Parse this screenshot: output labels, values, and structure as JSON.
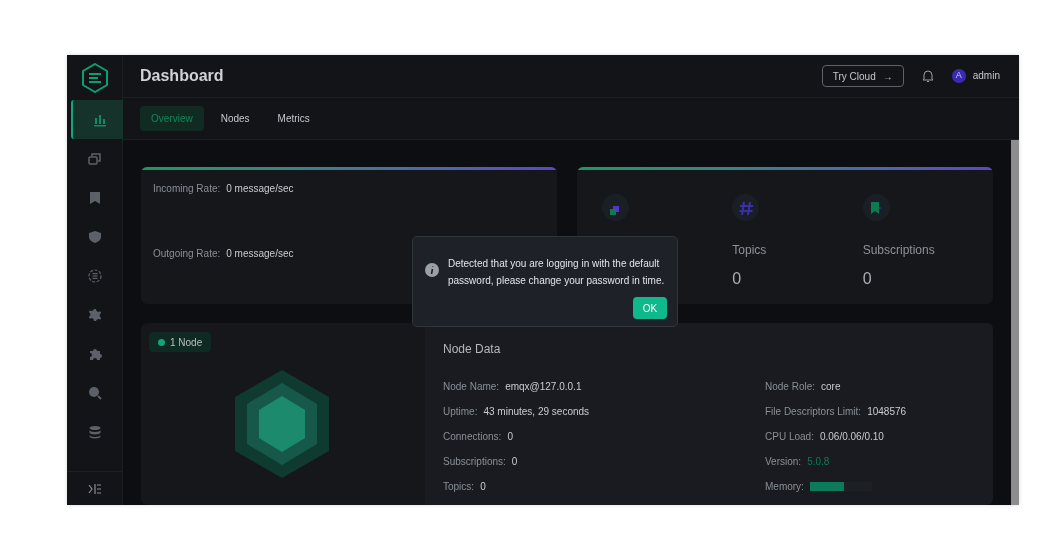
{
  "header": {
    "title": "Dashboard",
    "cloud_button": "Try Cloud",
    "cloud_arrow": "→",
    "avatar": "A",
    "user": "admin"
  },
  "sidebar": {
    "items": [
      {
        "kind": "chart",
        "selected": true
      },
      {
        "kind": "clients",
        "selected": false
      },
      {
        "kind": "bookmark",
        "selected": false
      },
      {
        "kind": "shield",
        "selected": false
      },
      {
        "kind": "list",
        "selected": false
      },
      {
        "kind": "gear",
        "selected": false
      },
      {
        "kind": "puzzle",
        "selected": false
      },
      {
        "kind": "search",
        "selected": false
      },
      {
        "kind": "database",
        "selected": false
      }
    ]
  },
  "tabs": [
    {
      "label": "Overview",
      "selected": true
    },
    {
      "label": "Nodes",
      "selected": false
    },
    {
      "label": "Metrics",
      "selected": false
    }
  ],
  "rates": [
    {
      "label": "Incoming Rate:",
      "value": "0 message/sec"
    },
    {
      "label": "Outgoing Rate:",
      "value": "0 message/sec"
    }
  ],
  "stats": [
    {
      "kind": "clients"
    },
    {
      "kind": "topics",
      "label": "Topics",
      "value": "0"
    },
    {
      "kind": "subscriptions",
      "label": "Subscriptions",
      "value": "0"
    }
  ],
  "nodes_badge": "1 Node",
  "node_data": {
    "title": "Node Data",
    "left": [
      {
        "label": "Node Name:",
        "value": "emqx@127.0.0.1"
      },
      {
        "label": "Uptime:",
        "value": "43 minutes, 29 seconds"
      },
      {
        "label": "Connections:",
        "value": "0"
      },
      {
        "label": "Subscriptions:",
        "value": "0"
      },
      {
        "label": "Topics:",
        "value": "0"
      }
    ],
    "right": [
      {
        "kind": "text",
        "label": "Node Role:",
        "value": "core"
      },
      {
        "kind": "text",
        "label": "File Descriptors Limit:",
        "value": "1048576"
      },
      {
        "kind": "text",
        "label": "CPU Load:",
        "value": "0.06/0.06/0.10"
      },
      {
        "kind": "version",
        "label": "Version:",
        "value": "5.0.8"
      },
      {
        "kind": "meter",
        "label": "Memory:",
        "level": 0.55
      }
    ]
  },
  "dialog": {
    "message": "Detected that you are logging in with the default password, please change your password in time.",
    "button": "OK"
  }
}
